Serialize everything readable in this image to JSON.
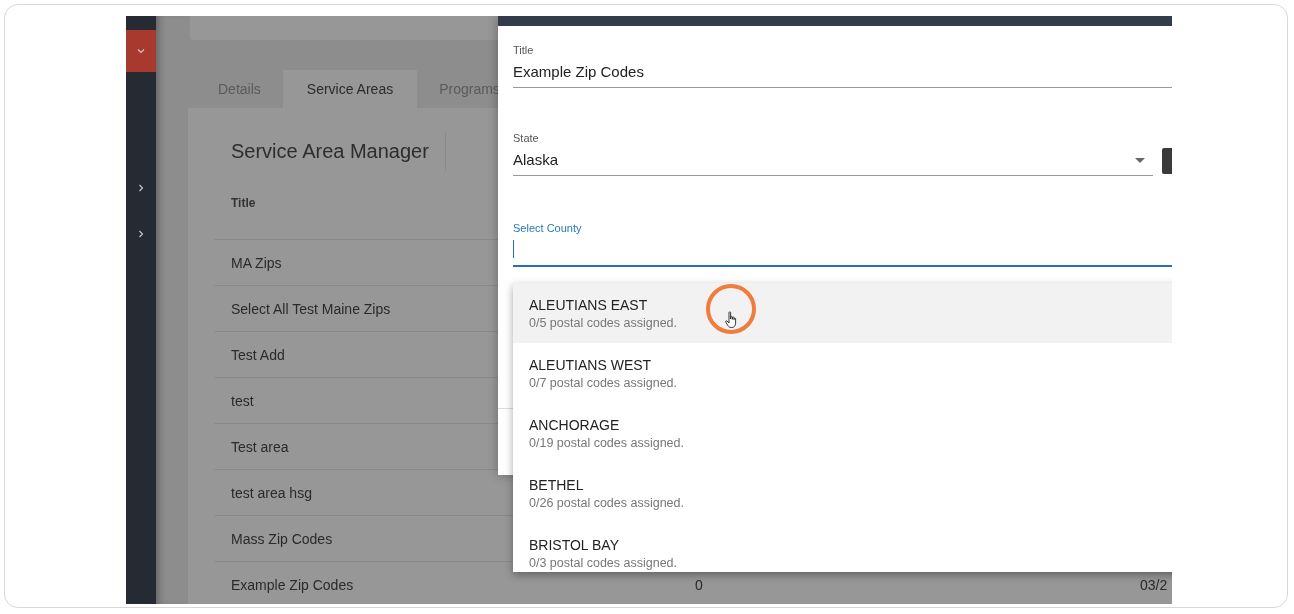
{
  "sidebar": {
    "items": [
      {
        "selected": true,
        "expanded": true
      },
      {
        "selected": false,
        "expanded": false
      },
      {
        "selected": false,
        "expanded": false
      }
    ]
  },
  "tabs": [
    {
      "label": "Details",
      "selected": false
    },
    {
      "label": "Service Areas",
      "selected": true
    },
    {
      "label": "Programs",
      "selected": false
    }
  ],
  "manager": {
    "title": "Service Area Manager",
    "columns": [
      "Title"
    ],
    "rows": [
      {
        "cells": [
          "MA Zips"
        ]
      },
      {
        "cells": [
          "Select All Test Maine Zips"
        ]
      },
      {
        "cells": [
          "Test Add"
        ]
      },
      {
        "cells": [
          "test"
        ]
      },
      {
        "cells": [
          "Test area"
        ]
      },
      {
        "cells": [
          "test area hsg"
        ]
      },
      {
        "cells": [
          "Mass Zip Codes"
        ]
      },
      {
        "cells": [
          "Example Zip Codes",
          "0",
          "03/2"
        ]
      }
    ]
  },
  "dialog": {
    "fields": [
      {
        "kind": "text",
        "label": "Title",
        "value": "Example Zip Codes",
        "focused": false
      },
      {
        "kind": "select",
        "label": "State",
        "value": "Alaska",
        "focused": false
      },
      {
        "kind": "text",
        "label": "Select County",
        "focused": true
      }
    ],
    "options": [
      {
        "name": "ALEUTIANS EAST",
        "detail": "0/5 postal codes assigned.",
        "selected": true
      },
      {
        "name": "ALEUTIANS WEST",
        "detail": "0/7 postal codes assigned.",
        "selected": false
      },
      {
        "name": "ANCHORAGE",
        "detail": "0/19 postal codes assigned.",
        "selected": false
      },
      {
        "name": "BETHEL",
        "detail": "0/26 postal codes assigned.",
        "selected": false
      },
      {
        "name": "BRISTOL BAY",
        "detail": "0/3 postal codes assigned.",
        "selected": false
      }
    ]
  }
}
